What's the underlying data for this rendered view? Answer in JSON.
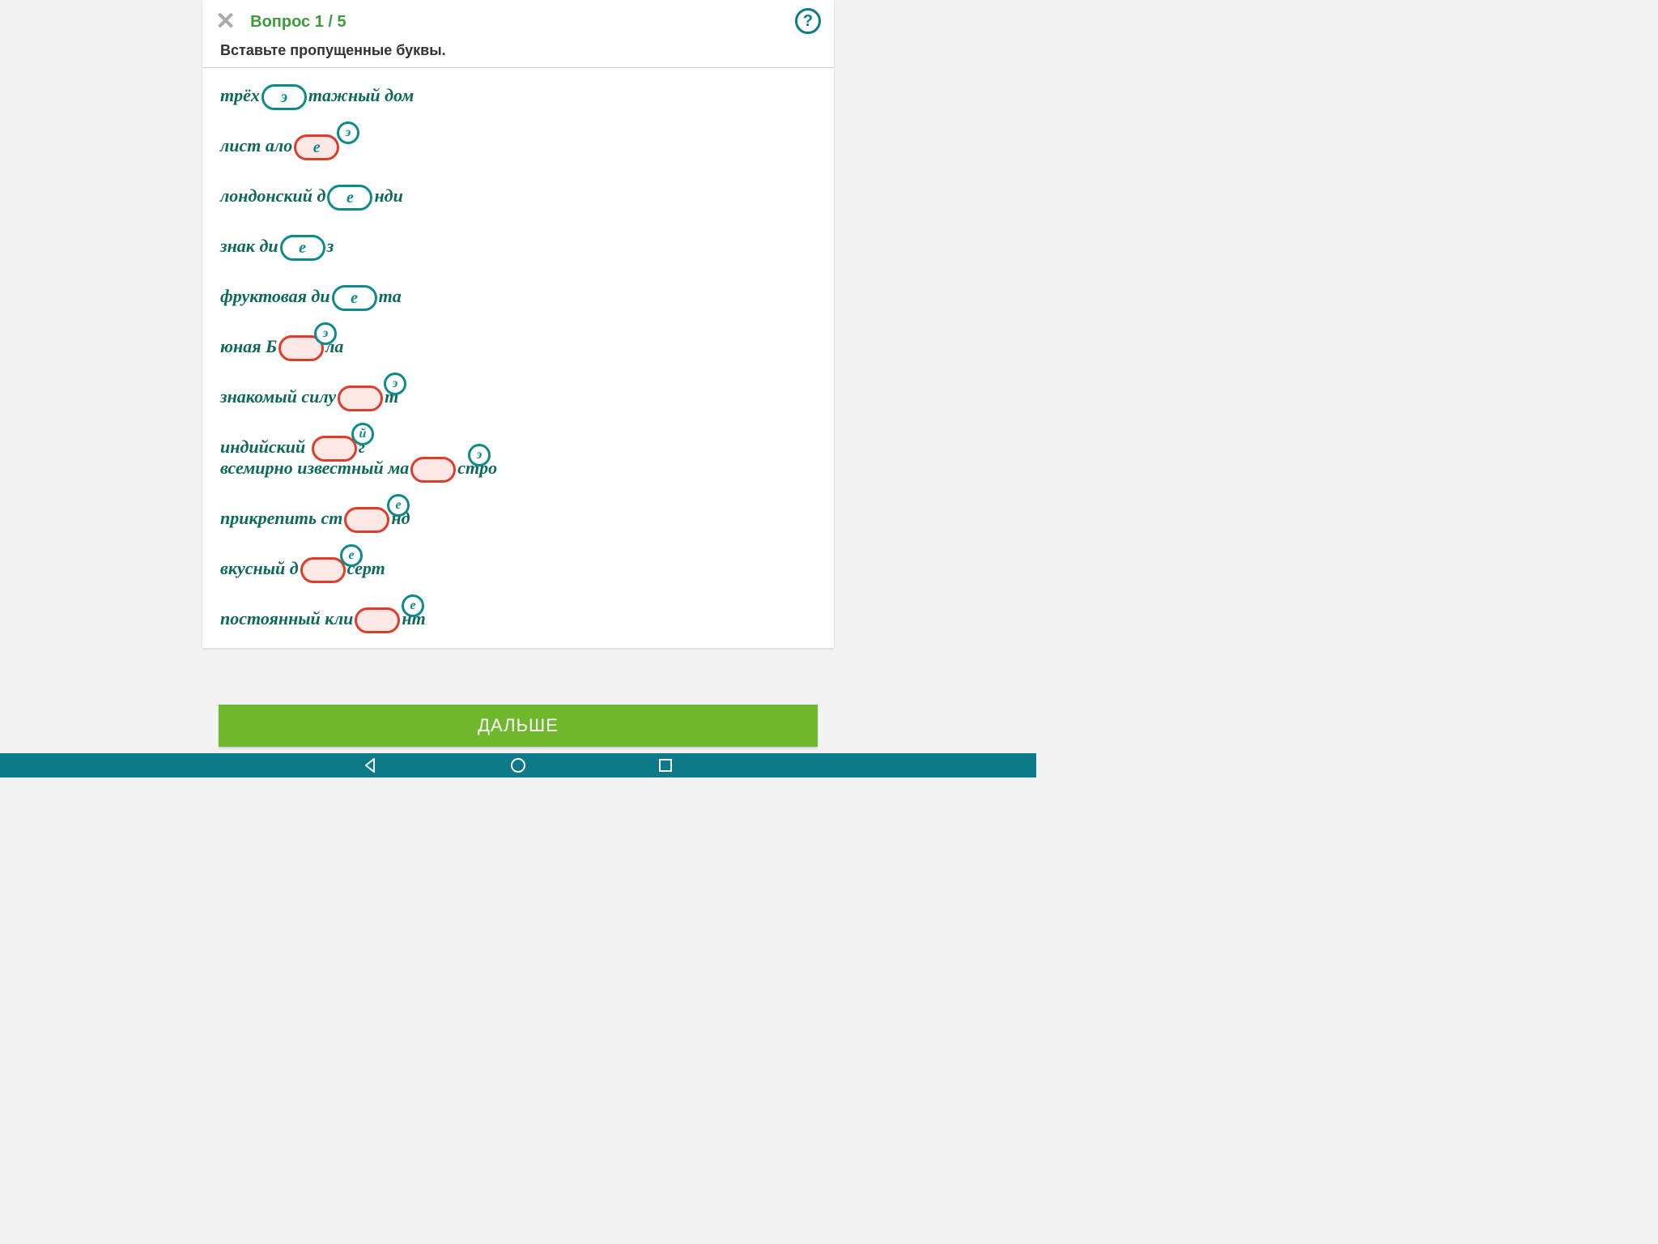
{
  "header": {
    "title": "Вопрос 1 / 5",
    "help": "?"
  },
  "instruction": "Вставьте пропущенные буквы.",
  "lines": [
    {
      "pre": "трёх",
      "pill": "э",
      "state": "correct",
      "post": "тажный дом",
      "badge": null,
      "badgeLeft": 0
    },
    {
      "pre": "лист ало",
      "pill": "е",
      "state": "wrong",
      "post": "",
      "badge": "э",
      "badgeLeft": 144
    },
    {
      "pre": "лондонский д",
      "pill": "е",
      "state": "correct",
      "post": "нди",
      "badge": null,
      "badgeLeft": 0
    },
    {
      "pre": "знак ди",
      "pill": "е",
      "state": "correct",
      "post": "з",
      "badge": null,
      "badgeLeft": 0
    },
    {
      "pre": "фруктовая ди",
      "pill": "е",
      "state": "correct",
      "post": "та",
      "badge": null,
      "badgeLeft": 0
    },
    {
      "pre": "юная Б",
      "pill": "",
      "state": "wrong",
      "post": "ла",
      "badge": "э",
      "badgeLeft": 116
    },
    {
      "pre": "знакомый силу",
      "pill": "",
      "state": "wrong",
      "post": "т",
      "badge": "э",
      "badgeLeft": 202
    },
    {
      "pre": "индийский ",
      "pill": "",
      "state": "wrong",
      "post": "г",
      "badge": "й",
      "badgeLeft": 162
    },
    {
      "pre": "всемирно известный ма",
      "pill": "",
      "state": "wrong",
      "post": "стро",
      "badge": "э",
      "badgeLeft": 306
    },
    {
      "pre": "прикрепить ст",
      "pill": "",
      "state": "wrong",
      "post": "нд",
      "badge": "е",
      "badgeLeft": 206
    },
    {
      "pre": "вкусный д",
      "pill": "",
      "state": "wrong",
      "post": "серт",
      "badge": "е",
      "badgeLeft": 148
    },
    {
      "pre": "постоянный кли",
      "pill": "",
      "state": "wrong",
      "post": "нт",
      "badge": "е",
      "badgeLeft": 224
    }
  ],
  "nextButton": "ДАЛЬШЕ"
}
